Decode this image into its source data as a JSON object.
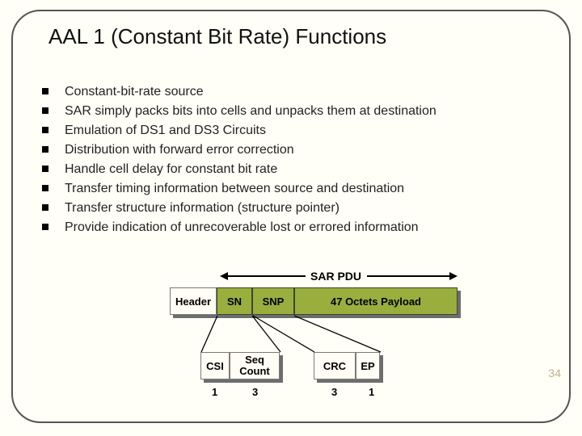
{
  "title": "AAL 1 (Constant Bit Rate) Functions",
  "bullets": [
    "Constant-bit-rate source",
    "SAR simply packs bits into cells and unpacks them at destination",
    "Emulation of DS1 and DS3 Circuits",
    "Distribution with forward error correction",
    "Handle cell delay for constant bit rate",
    "Transfer timing information between source and destination",
    "Transfer structure information (structure pointer)",
    "Provide indication of unrecoverable lost or errored information"
  ],
  "page_number": "34",
  "diagram": {
    "span_label": "SAR PDU",
    "row1": {
      "header": "Header",
      "sn": "SN",
      "snp": "SNP",
      "payload": "47 Octets Payload"
    },
    "row2": {
      "csi": "CSI",
      "seq": "Seq Count",
      "crc": "CRC",
      "ep": "EP"
    },
    "bits": {
      "csi": "1",
      "seq": "3",
      "crc": "3",
      "ep": "1"
    }
  },
  "chart_data": {
    "type": "table",
    "title": "AAL1 SAR PDU structure",
    "pdu_fields": [
      {
        "name": "SN",
        "expands_to": [
          "CSI",
          "Seq Count"
        ]
      },
      {
        "name": "SNP",
        "expands_to": [
          "CRC",
          "EP"
        ]
      },
      {
        "name": "47 Octets Payload"
      }
    ],
    "subfields_bits": [
      {
        "name": "CSI",
        "bits": 1
      },
      {
        "name": "Seq Count",
        "bits": 3
      },
      {
        "name": "CRC",
        "bits": 3
      },
      {
        "name": "EP",
        "bits": 1
      }
    ],
    "header_outside_pdu": "Header"
  }
}
